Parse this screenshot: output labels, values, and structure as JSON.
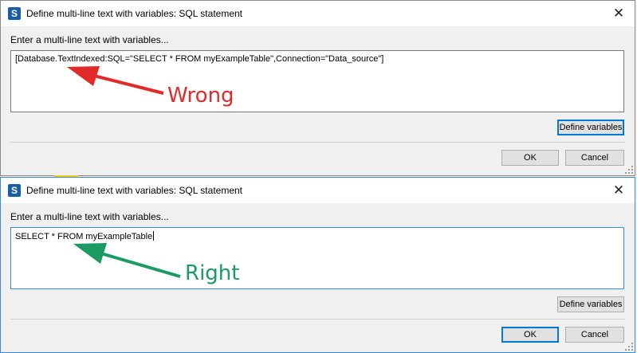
{
  "dialogs": [
    {
      "title": "Define multi-line text with variables: SQL statement",
      "prompt": "Enter a multi-line text with variables...",
      "text_value": "[Database.TextIndexed:SQL=\"SELECT * FROM myExampleTable\",Connection=\"Data_source\"]",
      "define_variables_label": "Define variables",
      "ok_label": "OK",
      "cancel_label": "Cancel",
      "annotation": "Wrong",
      "annotation_color": "#e22a2a"
    },
    {
      "title": "Define multi-line text with variables: SQL statement",
      "prompt": "Enter a multi-line text with variables...",
      "text_value": "SELECT * FROM myExampleTable",
      "define_variables_label": "Define variables",
      "ok_label": "OK",
      "cancel_label": "Cancel",
      "annotation": "Right",
      "annotation_color": "#1a9b64"
    }
  ],
  "app_icon_letter": "S",
  "icons": {
    "app": "app-s-icon",
    "close": "close-icon",
    "arrow": "arrow-icon",
    "grip": "resize-grip-icon"
  },
  "close_glyph": "✕",
  "colors": {
    "window_bg": "#f0f0f0",
    "titlebar_bg": "#ffffff",
    "focus_accent": "#0078d7"
  }
}
